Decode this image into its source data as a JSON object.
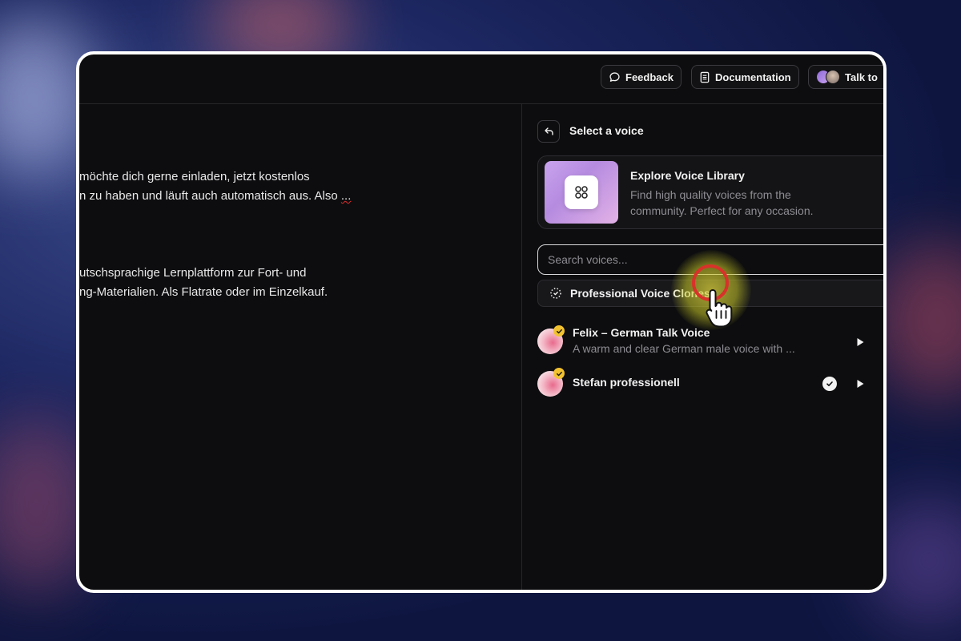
{
  "topbar": {
    "feedback_label": "Feedback",
    "documentation_label": "Documentation",
    "talk_label": "Talk to"
  },
  "editor": {
    "line1": "möchte dich gerne einladen, jetzt kostenlos",
    "line2a": "n zu haben und läuft auch automatisch aus. Also ",
    "line2b": "...",
    "line3": "utschsprachige Lernplattform zur Fort- und",
    "line4": "ng-Materialien. Als Flatrate oder im Einzelkauf."
  },
  "panel": {
    "title": "Select a voice",
    "library": {
      "title": "Explore Voice Library",
      "description": "Find high quality voices from the community. Perfect for any occasion."
    },
    "search": {
      "placeholder": "Search voices..."
    },
    "filter": {
      "label": "Professional Voice Clones"
    },
    "voices": [
      {
        "name": "Felix – German Talk Voice",
        "description": "A warm and clear German male voice with ...",
        "selected": false
      },
      {
        "name": "Stefan professionell",
        "description": "",
        "selected": true
      }
    ]
  },
  "colors": {
    "frame_border": "#ffffff",
    "app_background": "#0d0d0f",
    "verified_badge": "#f2c230",
    "cursor_ring": "#d8322a",
    "cursor_glow": "#dcd23c"
  }
}
